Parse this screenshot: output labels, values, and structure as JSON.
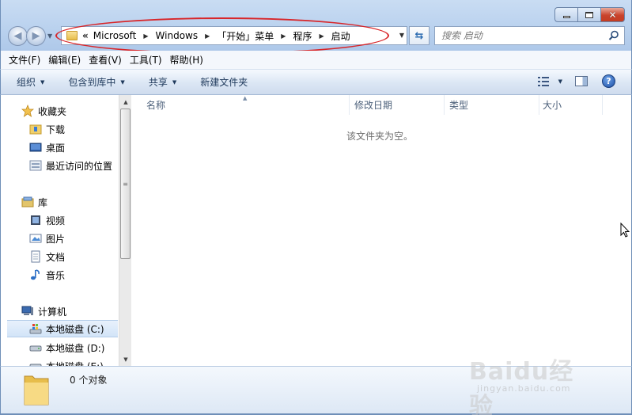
{
  "window": {
    "minimize_label": "",
    "maximize_label": "",
    "close_label": "✕"
  },
  "address": {
    "overflow": "«",
    "segments": [
      "Microsoft",
      "Windows",
      "「开始」菜单",
      "程序",
      "启动"
    ]
  },
  "search": {
    "placeholder": "搜索 启动"
  },
  "menubar": {
    "items": [
      "文件(F)",
      "编辑(E)",
      "查看(V)",
      "工具(T)",
      "帮助(H)"
    ]
  },
  "commandbar": {
    "organize": "组织",
    "include_in_library": "包含到库中",
    "share": "共享",
    "new_folder": "新建文件夹",
    "help": "?"
  },
  "navpane": {
    "favorites": {
      "label": "收藏夹",
      "items": [
        "下载",
        "桌面",
        "最近访问的位置"
      ]
    },
    "libraries": {
      "label": "库",
      "items": [
        "视频",
        "图片",
        "文档",
        "音乐"
      ]
    },
    "computer": {
      "label": "计算机",
      "items": [
        "本地磁盘 (C:)",
        "本地磁盘 (D:)",
        "本地磁盘 (E:)"
      ]
    }
  },
  "columns": [
    "名称",
    "修改日期",
    "类型",
    "大小"
  ],
  "content": {
    "empty_message": "该文件夹为空。"
  },
  "details": {
    "count": "0 个对象"
  },
  "watermark": {
    "brand": "Baidu经验",
    "url": "jingyan.baidu.com"
  },
  "colors": {
    "accent": "#1e395b",
    "highlight": "#d8262a",
    "frame": "#6f8fb8"
  }
}
